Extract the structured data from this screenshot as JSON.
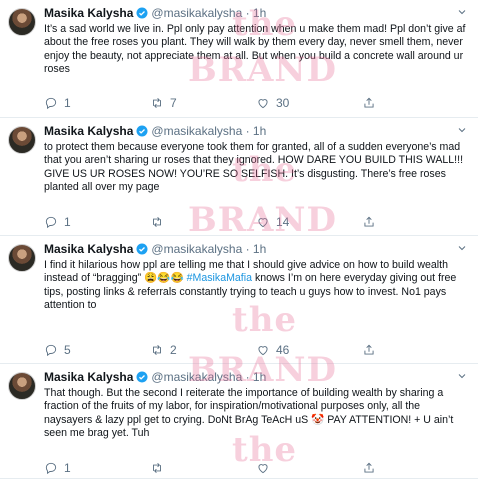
{
  "watermark": {
    "word1": "BRAND",
    "word2": "the"
  },
  "tweets": [
    {
      "name": "Masika Kalysha",
      "handle": "@masikakalysha · 1h",
      "text": "It’s a sad world we live in. Ppl only pay attention when u make them mad! Ppl don’t give af about the free roses you plant. They will walk by them every day, never smell them, never enjoy the beauty, not appreciate them at all. But when you build a concrete wall around ur roses",
      "reply_count": "1",
      "retweet_count": "7",
      "like_count": "30"
    },
    {
      "name": "Masika Kalysha",
      "handle": "@masikakalysha · 1h",
      "text": "to protect them because everyone took them for granted, all of a sudden everyone’s mad that you aren’t sharing ur roses that they ignored. HOW DARE YOU BUILD THIS WALL!!! GIVE US UR ROSES NOW! YOU’RE SO SELFISH. It’s disgusting. There’s free roses planted all over my page",
      "reply_count": "1",
      "retweet_count": "",
      "like_count": "14"
    },
    {
      "name": "Masika Kalysha",
      "handle": "@masikakalysha · 1h",
      "text_before": "I find it hilarious how ppl are telling me that I should give advice on how to build wealth instead of “bragging” 😩😂😂 ",
      "hashtag": "#MasikaMafia",
      "text_after": " knows I’m on here everyday giving out free tips, posting links & referrals constantly trying to teach u guys how to invest. No1 pays attention to",
      "reply_count": "5",
      "retweet_count": "2",
      "like_count": "46"
    },
    {
      "name": "Masika Kalysha",
      "handle": "@masikakalysha · 1h",
      "text": "That though. But the second I reiterate the importance of building wealth by sharing a fraction of the fruits of my labor, for inspiration/motivational purposes only, all the naysayers & lazy ppl get to crying. DoNt BrAg TeAcH uS 🤡 PAY ATTENTION! + U ain’t seen me brag yet. Tuh",
      "reply_count": "1",
      "retweet_count": "",
      "like_count": ""
    }
  ]
}
